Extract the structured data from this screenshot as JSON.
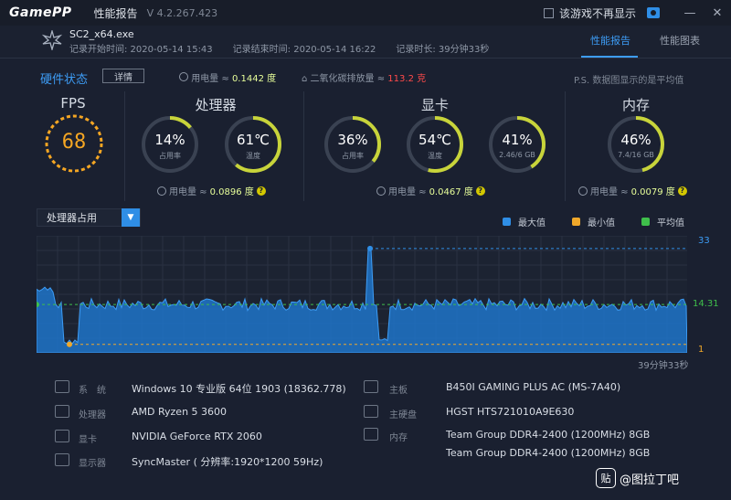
{
  "titlebar": {
    "logo": "GamePP",
    "title": "性能报告",
    "version": "V 4.2.267.423",
    "no_show_label": "该游戏不再显示",
    "minimize": "—",
    "close": "✕"
  },
  "session": {
    "exe": "SC2_x64.exe",
    "start": "记录开始时间: 2020-05-14 15:43",
    "end": "记录结束时间: 2020-05-14 16:22",
    "duration": "记录时长: 39分钟33秒"
  },
  "tabs": [
    {
      "label": "性能报告",
      "active": true
    },
    {
      "label": "性能图表",
      "active": false
    }
  ],
  "hardware": {
    "title": "硬件状态",
    "detail_button": "详情",
    "power_label": "用电量 ≈",
    "power_value": "0.1442 度",
    "co2_label": "二氧化碳排放量 ≈",
    "co2_value": "113.2 克",
    "note": "P.S. 数据图显示的是平均值"
  },
  "fps": {
    "title": "FPS",
    "value": "68"
  },
  "cpu": {
    "title": "处理器",
    "usage": {
      "value": "14%",
      "sub": "占用率",
      "fraction": 0.14
    },
    "temp": {
      "value": "61℃",
      "sub": "温度",
      "fraction": 0.61
    },
    "power_label": "用电量 ≈",
    "power_value": "0.0896 度"
  },
  "gpu": {
    "title": "显卡",
    "usage": {
      "value": "36%",
      "sub": "占用率",
      "fraction": 0.36
    },
    "temp": {
      "value": "54℃",
      "sub": "温度",
      "fraction": 0.54
    },
    "vram": {
      "value": "41%",
      "sub": "2.46/6 GB",
      "fraction": 0.41
    },
    "power_label": "用电量 ≈",
    "power_value": "0.0467 度"
  },
  "memory": {
    "title": "内存",
    "usage": {
      "value": "46%",
      "sub": "7.4/16 GB",
      "fraction": 0.46
    },
    "power_label": "用电量 ≈",
    "power_value": "0.0079 度"
  },
  "chart_select": {
    "label": "处理器占用"
  },
  "legend": {
    "max": "最大值",
    "min": "最小值",
    "avg": "平均值"
  },
  "colors": {
    "accent": "#3d9cf5",
    "max": "#2f8ee6",
    "min": "#f0a82a",
    "avg": "#3fbf4b",
    "fps_ring": "#f5a623",
    "warm_ring": "#c8d43a"
  },
  "chart_data": {
    "type": "area",
    "max_label": "33",
    "avg_label": "14.31",
    "min_label": "1",
    "ylim": [
      0,
      36
    ],
    "max_value": 33,
    "avg_value": 14.31,
    "min_value": 1,
    "x_end_label": "39分钟33秒"
  },
  "system": [
    {
      "label": "系　统",
      "value": "Windows 10 专业版 64位  1903 (18362.778)"
    },
    {
      "label": "处理器",
      "value": "AMD Ryzen 5 3600"
    },
    {
      "label": "显卡",
      "value": "NVIDIA GeForce RTX 2060"
    },
    {
      "label": "显示器",
      "value": "SyncMaster ( 分辨率:1920*1200 59Hz)"
    }
  ],
  "system_right": [
    {
      "label": "主板",
      "value": "B450I GAMING PLUS AC (MS-7A40)"
    },
    {
      "label": "主硬盘",
      "value": "HGST HTS721010A9E630"
    },
    {
      "label": "内存",
      "value": "Team Group DDR4-2400 (1200MHz) 8GB"
    },
    {
      "label": "",
      "value": "Team Group DDR4-2400 (1200MHz) 8GB"
    }
  ],
  "watermark": {
    "box": "贴",
    "text": "@图拉丁吧"
  }
}
